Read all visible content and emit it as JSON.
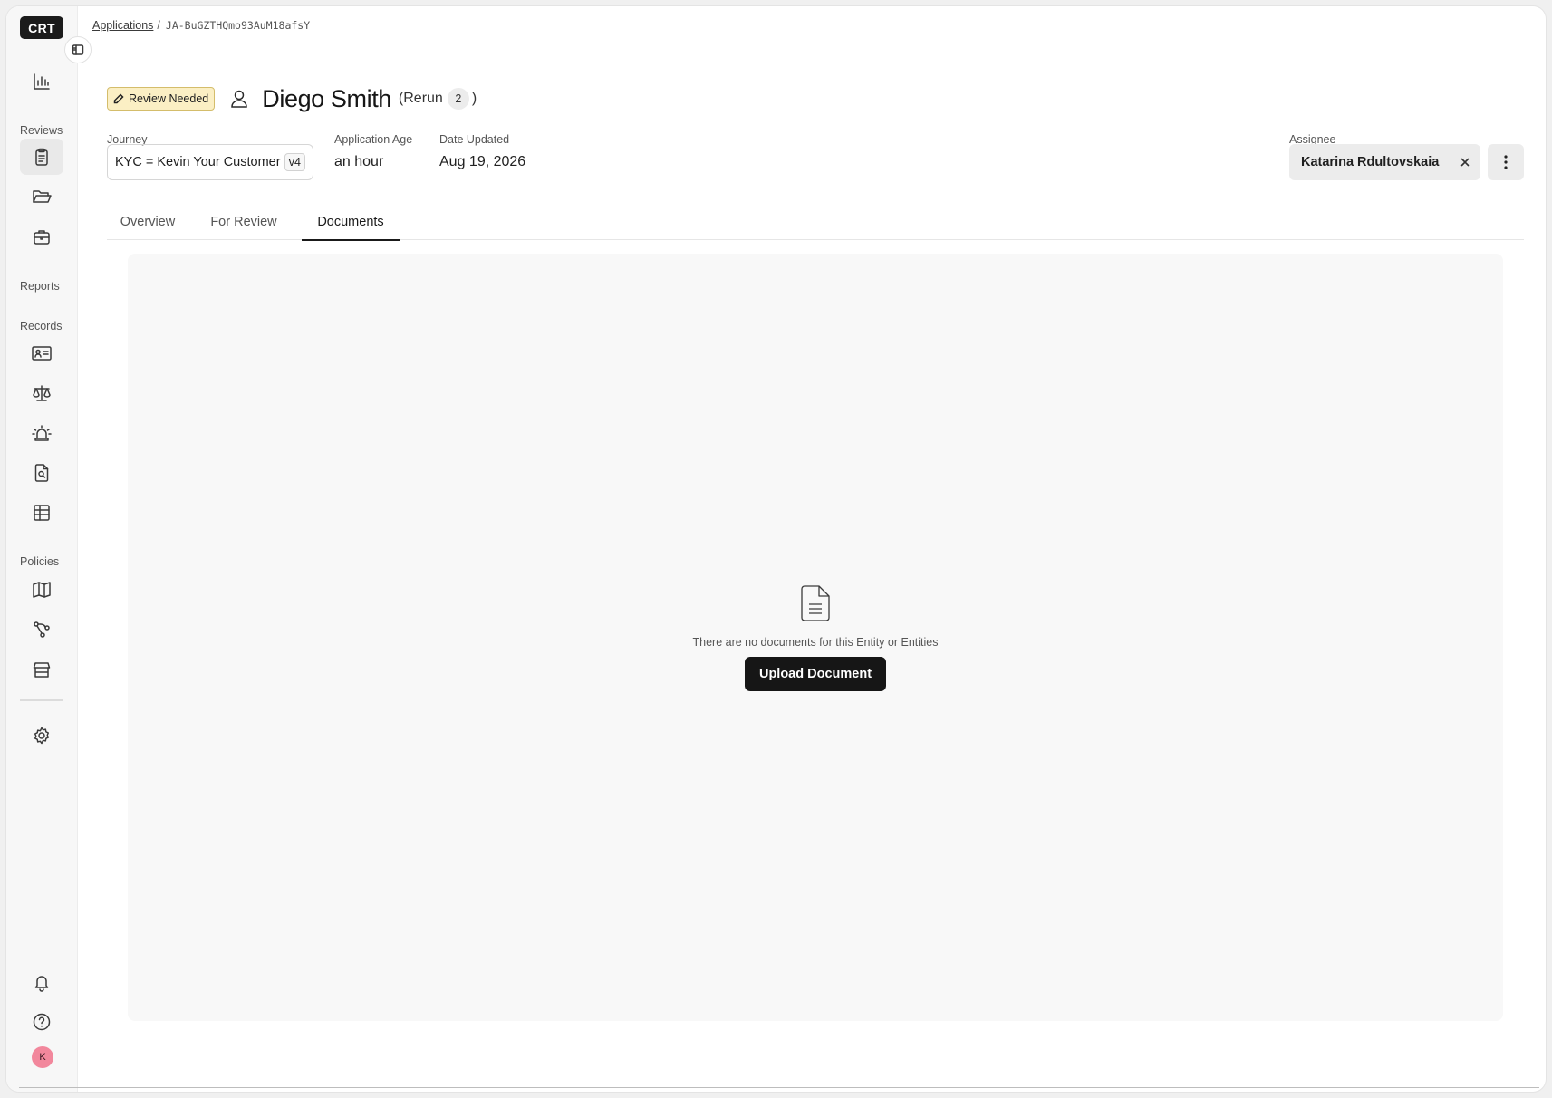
{
  "sidebar": {
    "logo": "CRT",
    "sections": {
      "reviews": "Reviews",
      "reports": "Reports",
      "records": "Records",
      "policies": "Policies"
    },
    "avatar_initial": "K"
  },
  "breadcrumb": {
    "parent": "Applications",
    "separator": "/",
    "current": "JA-BuGZTHQmo93AuM18afsY"
  },
  "header": {
    "status": "Review Needed",
    "entity_name": "Diego Smith",
    "rerun_open": "(Rerun",
    "rerun_count": "2",
    "rerun_close": ")"
  },
  "fields": {
    "journey_label": "Journey",
    "journey_value": "KYC = Kevin Your Customer",
    "journey_version": "v4",
    "age_label": "Application Age",
    "age_value": "an hour",
    "updated_label": "Date Updated",
    "updated_value": "Aug 19, 2026",
    "assignee_label": "Assignee",
    "assignee_value": "Katarina Rdultovskaia"
  },
  "tabs": [
    {
      "label": "Overview"
    },
    {
      "label": "For Review"
    },
    {
      "label": "Documents",
      "active": true
    }
  ],
  "documents": {
    "empty_message": "There are no documents for this Entity or Entities",
    "upload_label": "Upload Document"
  },
  "colors": {
    "status_badge_bg": "#fbefc4",
    "primary_button": "#161616",
    "avatar_bg": "#f2879c"
  }
}
